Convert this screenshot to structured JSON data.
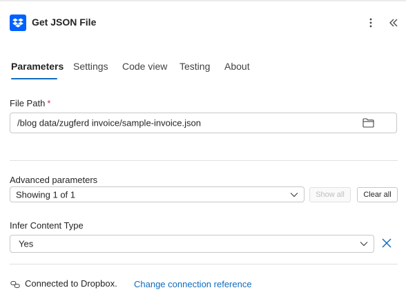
{
  "header": {
    "title": "Get JSON File",
    "icon": "dropbox-icon",
    "brand_color": "#0061fe"
  },
  "tabs": [
    {
      "label": "Parameters",
      "active": true
    },
    {
      "label": "Settings",
      "active": false
    },
    {
      "label": "Code view",
      "active": false
    },
    {
      "label": "Testing",
      "active": false
    },
    {
      "label": "About",
      "active": false
    }
  ],
  "file_path": {
    "label": "File Path",
    "required_marker": "*",
    "value": "/blog data/zugferd invoice/sample-invoice.json"
  },
  "advanced": {
    "label": "Advanced parameters",
    "value": "Showing 1 of 1",
    "show_all_label": "Show all",
    "clear_all_label": "Clear all"
  },
  "infer_content_type": {
    "label": "Infer Content Type",
    "value": "Yes"
  },
  "footer": {
    "status_text": "Connected to Dropbox.",
    "link_text": "Change connection reference"
  },
  "colors": {
    "accent": "#0f6cbd",
    "required": "#c4314b"
  }
}
